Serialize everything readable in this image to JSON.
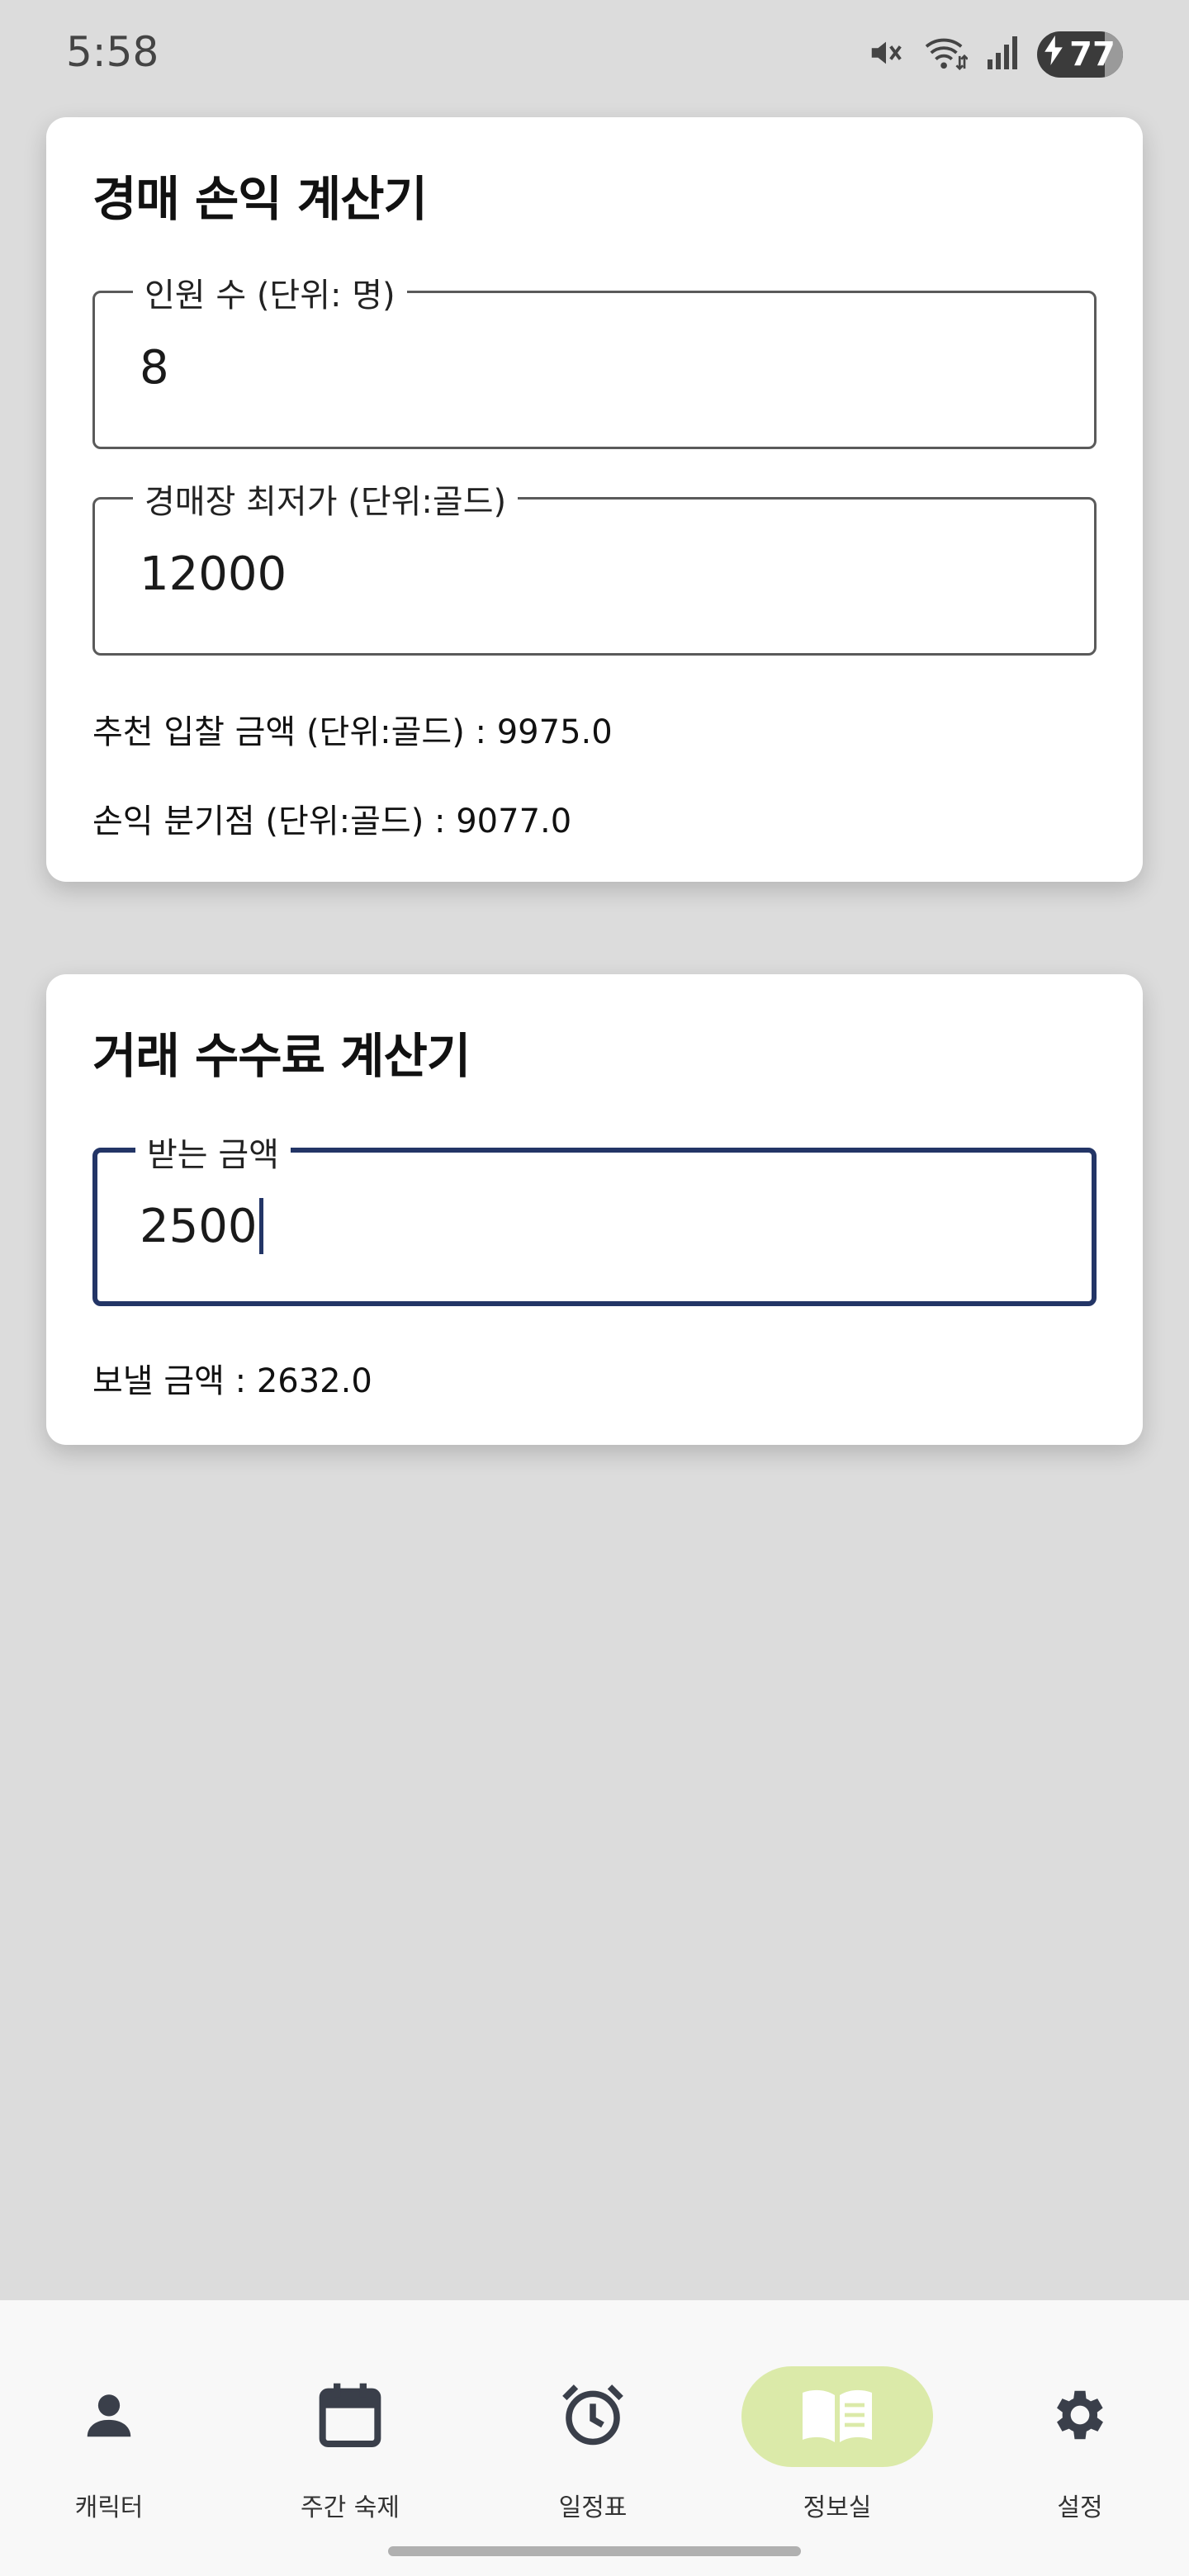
{
  "status_bar": {
    "time": "5:58",
    "battery": "77"
  },
  "auction_calc": {
    "title": "경매 손익 계산기",
    "people_label": "인원 수 (단위: 명)",
    "people_value": "8",
    "min_price_label": "경매장 최저가 (단위:골드)",
    "min_price_value": "12000",
    "recommended_bid": "추천 입찰 금액 (단위:골드) : 9975.0",
    "break_even": "손익 분기점 (단위:골드) : 9077.0"
  },
  "fee_calc": {
    "title": "거래 수수료 계산기",
    "receive_label": "받는 금액",
    "receive_value": "2500",
    "send_amount": "보낼 금액 : 2632.0"
  },
  "bottom_nav": {
    "items": [
      {
        "label": "캐릭터",
        "icon": "person-icon"
      },
      {
        "label": "주간 숙제",
        "icon": "calendar-icon"
      },
      {
        "label": "일정표",
        "icon": "alarm-clock-icon"
      },
      {
        "label": "정보실",
        "icon": "book-icon",
        "active": true
      },
      {
        "label": "설정",
        "icon": "gear-icon"
      }
    ],
    "active_color": "#dbeaa9"
  },
  "colors": {
    "focus_border": "#233566",
    "background": "#dcdcdc"
  }
}
